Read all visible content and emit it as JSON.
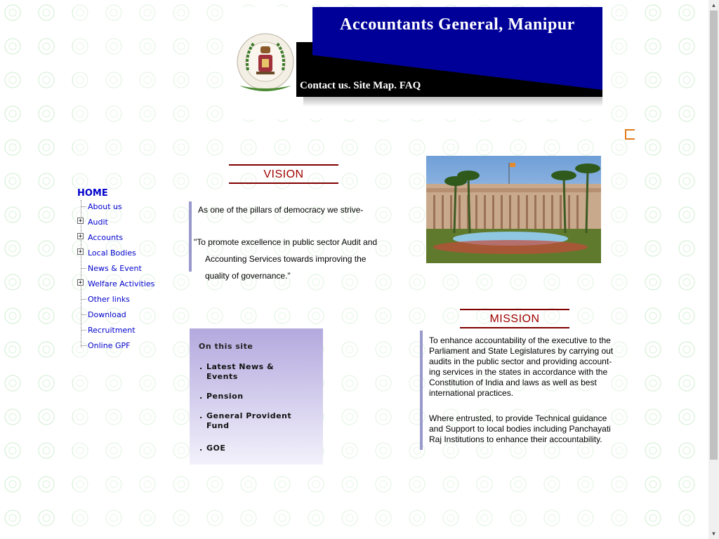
{
  "header": {
    "title": "Accountants General, Manipur",
    "links": [
      "Contact us.",
      "Site Map.",
      "FAQ"
    ],
    "logo_icon": "emblem-logo-icon"
  },
  "nav": {
    "home": "HOME",
    "items": [
      {
        "label": "About us",
        "expandable": false
      },
      {
        "label": "Audit",
        "expandable": true
      },
      {
        "label": "Accounts",
        "expandable": true
      },
      {
        "label": "Local Bodies",
        "expandable": true
      },
      {
        "label": "News & Event",
        "expandable": false
      },
      {
        "label": "Welfare Activities",
        "expandable": true
      },
      {
        "label": "Other links",
        "expandable": false
      },
      {
        "label": "Download",
        "expandable": false
      },
      {
        "label": "Recruitment",
        "expandable": false
      },
      {
        "label": "Online GPF",
        "expandable": false
      }
    ]
  },
  "vision": {
    "heading": "VISION",
    "intro": "As one of the pillars of democracy we strive-",
    "quote_lines": [
      "\"To promote excellence in public sector Audit and",
      "Accounting Services towards improving the",
      "quality of governance.\""
    ]
  },
  "on_this_site": {
    "title": "On this site",
    "items": [
      {
        "bullet": ".",
        "label": "Latest News & Events"
      },
      {
        "bullet": ".",
        "label": "Pension"
      },
      {
        "bullet": ".",
        "label": "General Provident Fund"
      },
      {
        "bullet": ".",
        "label": "GOE"
      }
    ]
  },
  "mission": {
    "heading": "MISSION",
    "paragraphs": [
      "To enhance accountability of the executive to the Parliament and State Legislatures by carrying out audits in the public sector and providing account-ing services in the states in accordance with the Constitution of India and laws as well as best international practices.",
      "Where entrusted, to provide Technical guidance and Support to local bodies including Panchayati Raj Institutions to enhance their accountability."
    ]
  },
  "colors": {
    "banner_blue": "#000099",
    "heading_red": "#a00000",
    "link_blue": "#0000cc",
    "accent_orange": "#e07b1a"
  }
}
